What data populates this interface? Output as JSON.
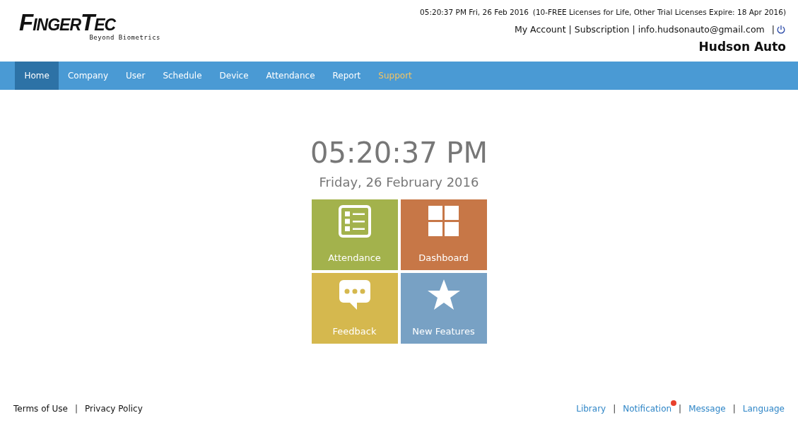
{
  "logo": {
    "name": "FingerTec",
    "tagline": "Beyond Biometrics"
  },
  "header": {
    "datetime": "05:20:37 PM Fri, 26 Feb 2016",
    "license_note": "(10-FREE Licenses for Life, Other Trial Licenses Expire:  18 Apr 2016)",
    "account_links": [
      {
        "label": "My Account"
      },
      {
        "label": "Subscription"
      },
      {
        "label": "info.hudsonauto@gmail.com"
      }
    ],
    "separator": "|",
    "company": "Hudson Auto"
  },
  "nav": [
    {
      "label": "Home",
      "selected": true,
      "highlighted": false
    },
    {
      "label": "Company",
      "selected": false,
      "highlighted": false
    },
    {
      "label": "User",
      "selected": false,
      "highlighted": false
    },
    {
      "label": "Schedule",
      "selected": false,
      "highlighted": false
    },
    {
      "label": "Device",
      "selected": false,
      "highlighted": false
    },
    {
      "label": "Attendance",
      "selected": false,
      "highlighted": false
    },
    {
      "label": "Report",
      "selected": false,
      "highlighted": false
    },
    {
      "label": "Support",
      "selected": false,
      "highlighted": true
    }
  ],
  "clock": {
    "time": "05:20:37 PM",
    "date": "Friday, 26 February 2016"
  },
  "tiles": [
    {
      "label": "Attendance",
      "kind": "list",
      "color": "#a3b24c"
    },
    {
      "label": "Dashboard",
      "kind": "grid",
      "color": "#c77747"
    },
    {
      "label": "Feedback",
      "kind": "chat",
      "color": "#d5b84e"
    },
    {
      "label": "New Features",
      "kind": "star",
      "color": "#78a1c4"
    }
  ],
  "footer": {
    "left": [
      {
        "label": "Terms of Use",
        "badge": false
      },
      {
        "label": "Privacy Policy",
        "badge": false
      }
    ],
    "right": [
      {
        "label": "Library",
        "badge": false
      },
      {
        "label": "Notification",
        "badge": true
      },
      {
        "label": "Message",
        "badge": false
      },
      {
        "label": "Language",
        "badge": false
      }
    ],
    "separator": "|"
  }
}
